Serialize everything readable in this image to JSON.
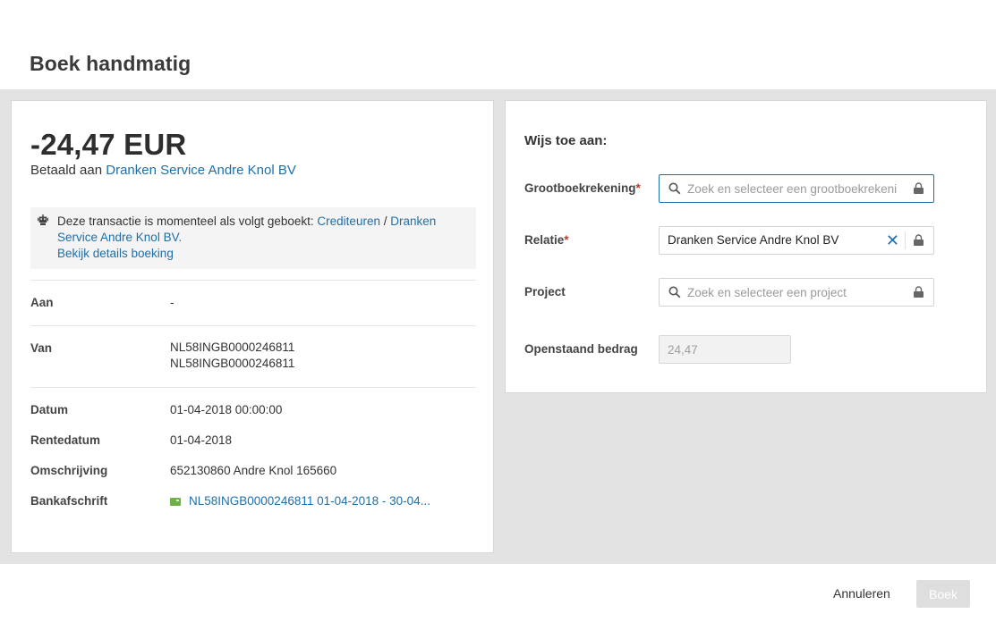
{
  "dialog": {
    "title": "Boek handmatig"
  },
  "transaction": {
    "amount": "-24,47 EUR",
    "paid_to_prefix": "Betaald aan",
    "paid_to_name": "Dranken Service Andre Knol BV",
    "info": {
      "text": "Deze transactie is momenteel als volgt geboekt:",
      "link_crediteuren": "Crediteuren",
      "separator": "/",
      "link_relation": "Dranken Service Andre Knol BV.",
      "details_link": "Bekijk details boeking"
    },
    "rows": {
      "aan_label": "Aan",
      "aan_value": "-",
      "van_label": "Van",
      "van_value_1": "NL58INGB0000246811",
      "van_value_2": "NL58INGB0000246811",
      "datum_label": "Datum",
      "datum_value": "01-04-2018 00:00:00",
      "rentedatum_label": "Rentedatum",
      "rentedatum_value": "01-04-2018",
      "omschrijving_label": "Omschrijving",
      "omschrijving_value": "652130860 Andre Knol 165660",
      "bankafschrift_label": "Bankafschrift",
      "bankafschrift_value": "NL58INGB0000246811 01-04-2018 - 30-04..."
    }
  },
  "assign": {
    "title": "Wijs toe aan:",
    "grootboek_label": "Grootboekrekening",
    "grootboek_placeholder": "Zoek en selecteer een grootboekrekeni",
    "relatie_label": "Relatie",
    "relatie_value": "Dranken Service Andre Knol BV",
    "project_label": "Project",
    "project_placeholder": "Zoek en selecteer een project",
    "openstaand_label": "Openstaand bedrag",
    "openstaand_value": "24,47",
    "required_mark": "*"
  },
  "footer": {
    "cancel_label": "Annuleren",
    "book_label": "Boek"
  },
  "colors": {
    "link": "#1f6fa8",
    "required": "#c0392b",
    "bank_icon": "#6fb04a",
    "backdrop": "#e3e3e3"
  },
  "icons": {
    "search": "search-icon",
    "lock": "lock-icon",
    "clear": "clear-icon",
    "robot": "robot-icon",
    "bank": "bank-statement-icon"
  }
}
